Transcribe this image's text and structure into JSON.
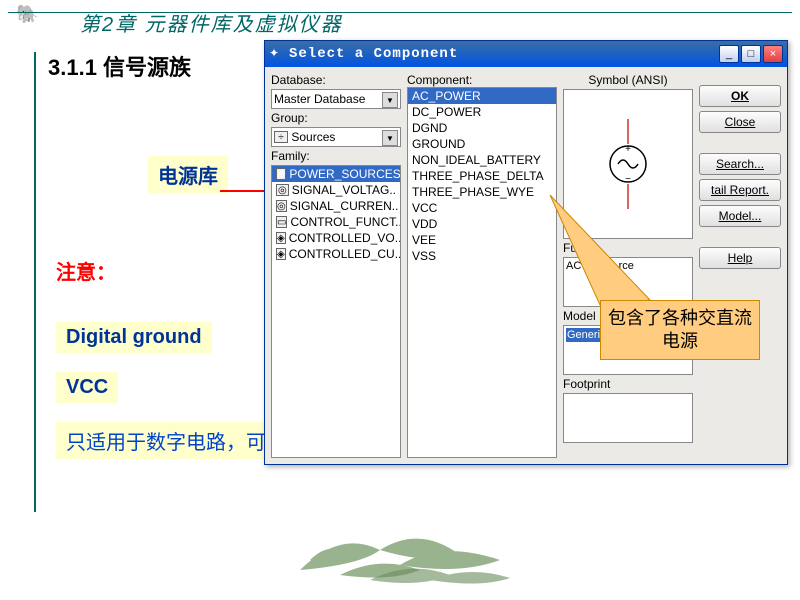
{
  "chapter": {
    "icon": "🐘",
    "title": "第2章   元器件库及虚拟仪器"
  },
  "section_title": "3.1.1 信号源族",
  "labels": {
    "power_lib": "电源库",
    "note": "注意：",
    "digital_ground": "Digital ground",
    "vcc": "VCC",
    "bottom_text": "只适用于数字电路，可不与任何器件相连接"
  },
  "callout_text": "包含了各种交直流电源",
  "dialog": {
    "title": "Select a Component",
    "left": {
      "database_label": "Database:",
      "database_value": "Master Database",
      "group_label": "Group:",
      "group_value": "Sources",
      "family_label": "Family:",
      "families": [
        "POWER_SOURCES",
        "SIGNAL_VOLTAG..",
        "SIGNAL_CURREN..",
        "CONTROL_FUNCT..",
        "CONTROLLED_VO..",
        "CONTROLLED_CU.."
      ]
    },
    "mid": {
      "component_label": "Component:",
      "components": [
        "AC_POWER",
        "DC_POWER",
        "DGND",
        "GROUND",
        "NON_IDEAL_BATTERY",
        "THREE_PHASE_DELTA",
        "THREE_PHASE_WYE",
        "VCC",
        "VDD",
        "VEE",
        "VSS"
      ]
    },
    "right": {
      "symbol_label": "Symbol (ANSI)",
      "function_label": "Functi",
      "function_value": "AC Power rce",
      "model_label": "Model Manu",
      "model_value": "Generic\\V",
      "footprint_label": "Footprint"
    },
    "buttons": {
      "ok": "OK",
      "close": "Close",
      "search": "Search...",
      "detail": "tail Report.",
      "model": "Model...",
      "help": "Help"
    }
  }
}
